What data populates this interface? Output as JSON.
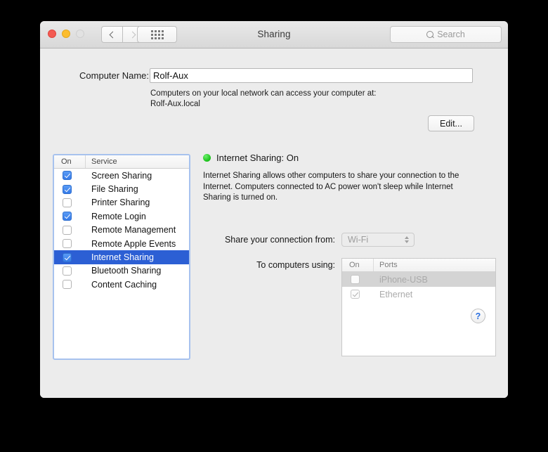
{
  "window": {
    "title": "Sharing",
    "traffic_lights": [
      "close-button",
      "minimize-button",
      "zoom-button"
    ]
  },
  "toolbar": {
    "back_icon": "chevron-left-icon",
    "forward_icon": "chevron-right-icon",
    "show_all_icon": "grid-icon",
    "search_placeholder": "Search",
    "search_value": "",
    "search_icon": "magnifier-icon"
  },
  "computer_name": {
    "label": "Computer Name:",
    "value": "Rolf-Aux",
    "note_line1": "Computers on your local network can access your computer at:",
    "note_line2": "Rolf-Aux.local",
    "edit_button": "Edit..."
  },
  "services": {
    "columns": [
      "On",
      "Service"
    ],
    "items": [
      {
        "name": "Screen Sharing",
        "on": true,
        "selected": false
      },
      {
        "name": "File Sharing",
        "on": true,
        "selected": false
      },
      {
        "name": "Printer Sharing",
        "on": false,
        "selected": false
      },
      {
        "name": "Remote Login",
        "on": true,
        "selected": false
      },
      {
        "name": "Remote Management",
        "on": false,
        "selected": false
      },
      {
        "name": "Remote Apple Events",
        "on": false,
        "selected": false
      },
      {
        "name": "Internet Sharing",
        "on": true,
        "selected": true
      },
      {
        "name": "Bluetooth Sharing",
        "on": false,
        "selected": false
      },
      {
        "name": "Content Caching",
        "on": false,
        "selected": false
      }
    ]
  },
  "detail": {
    "status_text": "Internet Sharing: On",
    "status_indicator": "green",
    "description": "Internet Sharing allows other computers to share your connection to the Internet. Computers connected to AC power won't sleep while Internet Sharing is turned on.",
    "share_from_label": "Share your connection from:",
    "share_from_value": "Wi-Fi",
    "to_computers_label": "To computers using:",
    "ports_columns": [
      "On",
      "Ports"
    ],
    "ports": [
      {
        "name": "iPhone-USB",
        "on": false,
        "highlighted": true
      },
      {
        "name": "Ethernet",
        "on": true,
        "highlighted": false
      }
    ]
  },
  "help": {
    "label": "?"
  },
  "colors": {
    "accent_blue": "#2c5fd4",
    "checkbox_blue": "#357ae8",
    "status_green": "#18c018",
    "window_bg": "#ececec",
    "help_blue": "#2b6fe0"
  }
}
